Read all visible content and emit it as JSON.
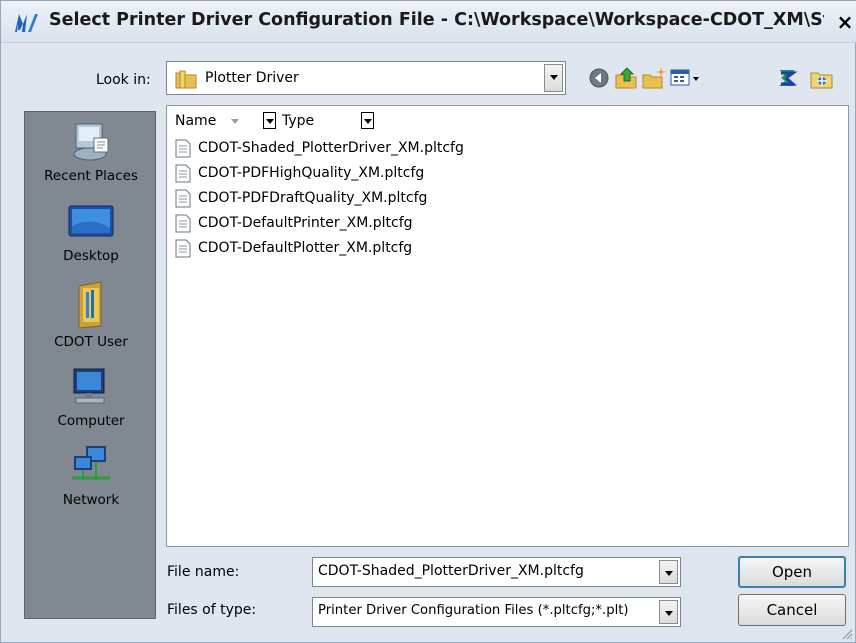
{
  "window": {
    "title": "Select Printer Driver Configuration File - C:\\Workspace\\Workspace-CDOT_XM\\St...",
    "close_label": "×"
  },
  "toolbar": {
    "look_in_label": "Look in:",
    "look_in_value": "Plotter Driver",
    "icons": [
      "back-icon",
      "up-folder-icon",
      "new-folder-icon",
      "view-menu-icon",
      "network-icon",
      "configuration-icon"
    ]
  },
  "places": [
    {
      "label": "Recent Places",
      "icon": "recent-places-icon"
    },
    {
      "label": "Desktop",
      "icon": "desktop-icon"
    },
    {
      "label": "CDOT User",
      "icon": "user-folder-icon"
    },
    {
      "label": "Computer",
      "icon": "computer-icon"
    },
    {
      "label": "Network",
      "icon": "network-places-icon"
    }
  ],
  "columns": [
    {
      "label": "Name"
    },
    {
      "label": "Type"
    }
  ],
  "files": [
    {
      "name": "CDOT-Shaded_PlotterDriver_XM.pltcfg"
    },
    {
      "name": "CDOT-PDFHighQuality_XM.pltcfg"
    },
    {
      "name": "CDOT-PDFDraftQuality_XM.pltcfg"
    },
    {
      "name": "CDOT-DefaultPrinter_XM.pltcfg"
    },
    {
      "name": "CDOT-DefaultPlotter_XM.pltcfg"
    }
  ],
  "footer": {
    "file_name_label": "File name:",
    "file_name_value": "CDOT-Shaded_PlotterDriver_XM.pltcfg",
    "files_of_type_label": "Files of type:",
    "files_of_type_value": "Printer Driver Configuration Files (*.pltcfg;*.plt)",
    "open_label": "Open",
    "cancel_label": "Cancel"
  },
  "colors": {
    "title_bg": "#dfe6f0",
    "places_bg": "#808891",
    "default_button_border": "#3c7fb1"
  }
}
